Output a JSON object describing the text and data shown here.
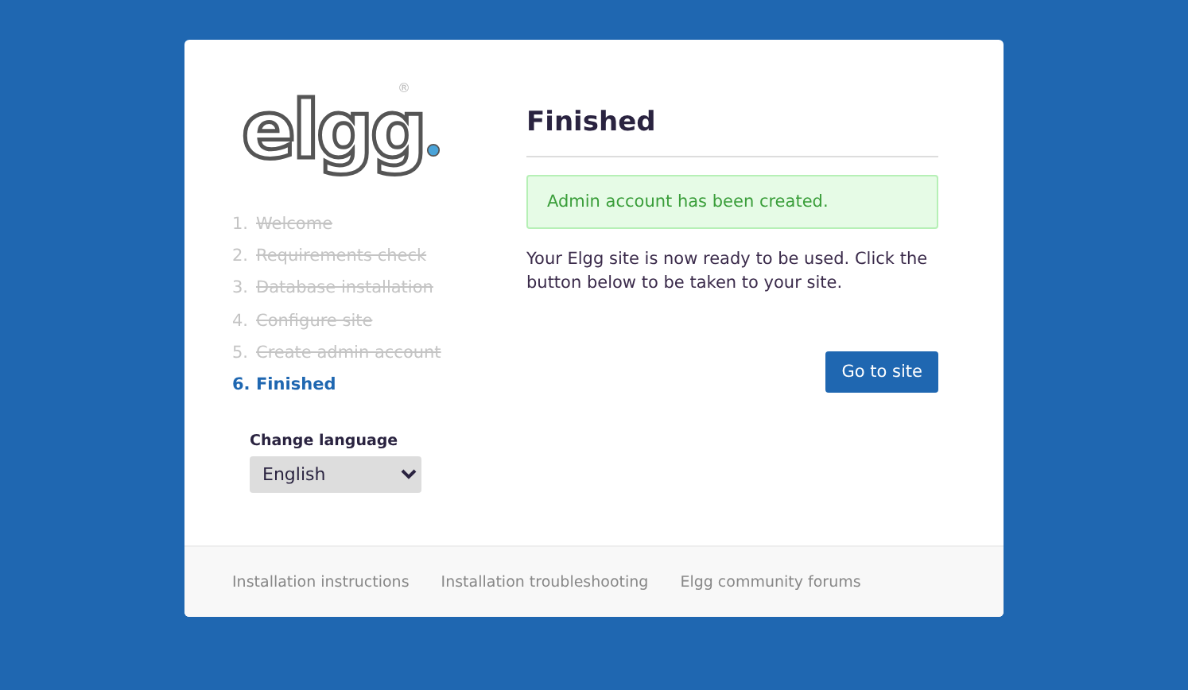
{
  "logo": {
    "text": "elgg",
    "mark": "®"
  },
  "steps": [
    {
      "number": "1.",
      "label": "Welcome",
      "done": true,
      "selected": false
    },
    {
      "number": "2.",
      "label": "Requirements check",
      "done": true,
      "selected": false
    },
    {
      "number": "3.",
      "label": "Database installation",
      "done": true,
      "selected": false
    },
    {
      "number": "4.",
      "label": "Configure site",
      "done": true,
      "selected": false
    },
    {
      "number": "5.",
      "label": "Create admin account",
      "done": true,
      "selected": false
    },
    {
      "number": "6.",
      "label": "Finished",
      "done": false,
      "selected": true
    }
  ],
  "language": {
    "label": "Change language",
    "value": "English"
  },
  "title": "Finished",
  "message": "Admin account has been created.",
  "body": "Your Elgg site is now ready to be used. Click the button below to be taken to your site.",
  "button": "Go to site",
  "footer_links": [
    "Installation instructions",
    "Installation troubleshooting",
    "Elgg community forums"
  ]
}
